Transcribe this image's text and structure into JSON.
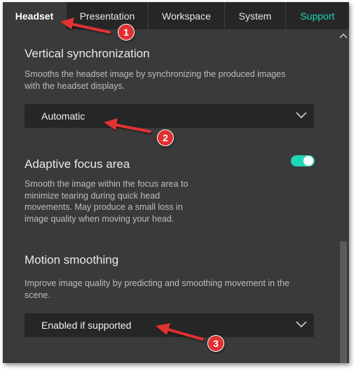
{
  "tabs": [
    {
      "label": "Headset",
      "active": true
    },
    {
      "label": "Presentation"
    },
    {
      "label": "Workspace"
    },
    {
      "label": "System"
    },
    {
      "label": "Support",
      "accent": true
    }
  ],
  "sections": {
    "vsync": {
      "title": "Vertical synchronization",
      "description_lines": [
        "Smooths the headset image by synchronizing the produced images",
        "with the headset displays."
      ],
      "selected": "Automatic"
    },
    "focus": {
      "title": "Adaptive focus area",
      "description_lines": [
        "Smooth the image within the focus area to",
        "minimize tearing during quick head",
        "movements. May produce a small loss in",
        "image quality when moving your head."
      ],
      "toggle_on": true
    },
    "motion": {
      "title": "Motion smoothing",
      "description_lines": [
        "Improve image quality by predicting and smoothing movement in the",
        "scene."
      ],
      "selected": "Enabled if supported"
    }
  },
  "annotations": [
    "1",
    "2",
    "3"
  ],
  "colors": {
    "accent": "#1ed7b4",
    "panel": "#3a3a3a",
    "tabbar": "#262626",
    "dropdown": "#262626",
    "callout": "#e03131"
  },
  "icons": {
    "dropdown": "chevron-down-icon",
    "scroll_up": "chevron-up-icon",
    "callout": "arrow-icon"
  }
}
